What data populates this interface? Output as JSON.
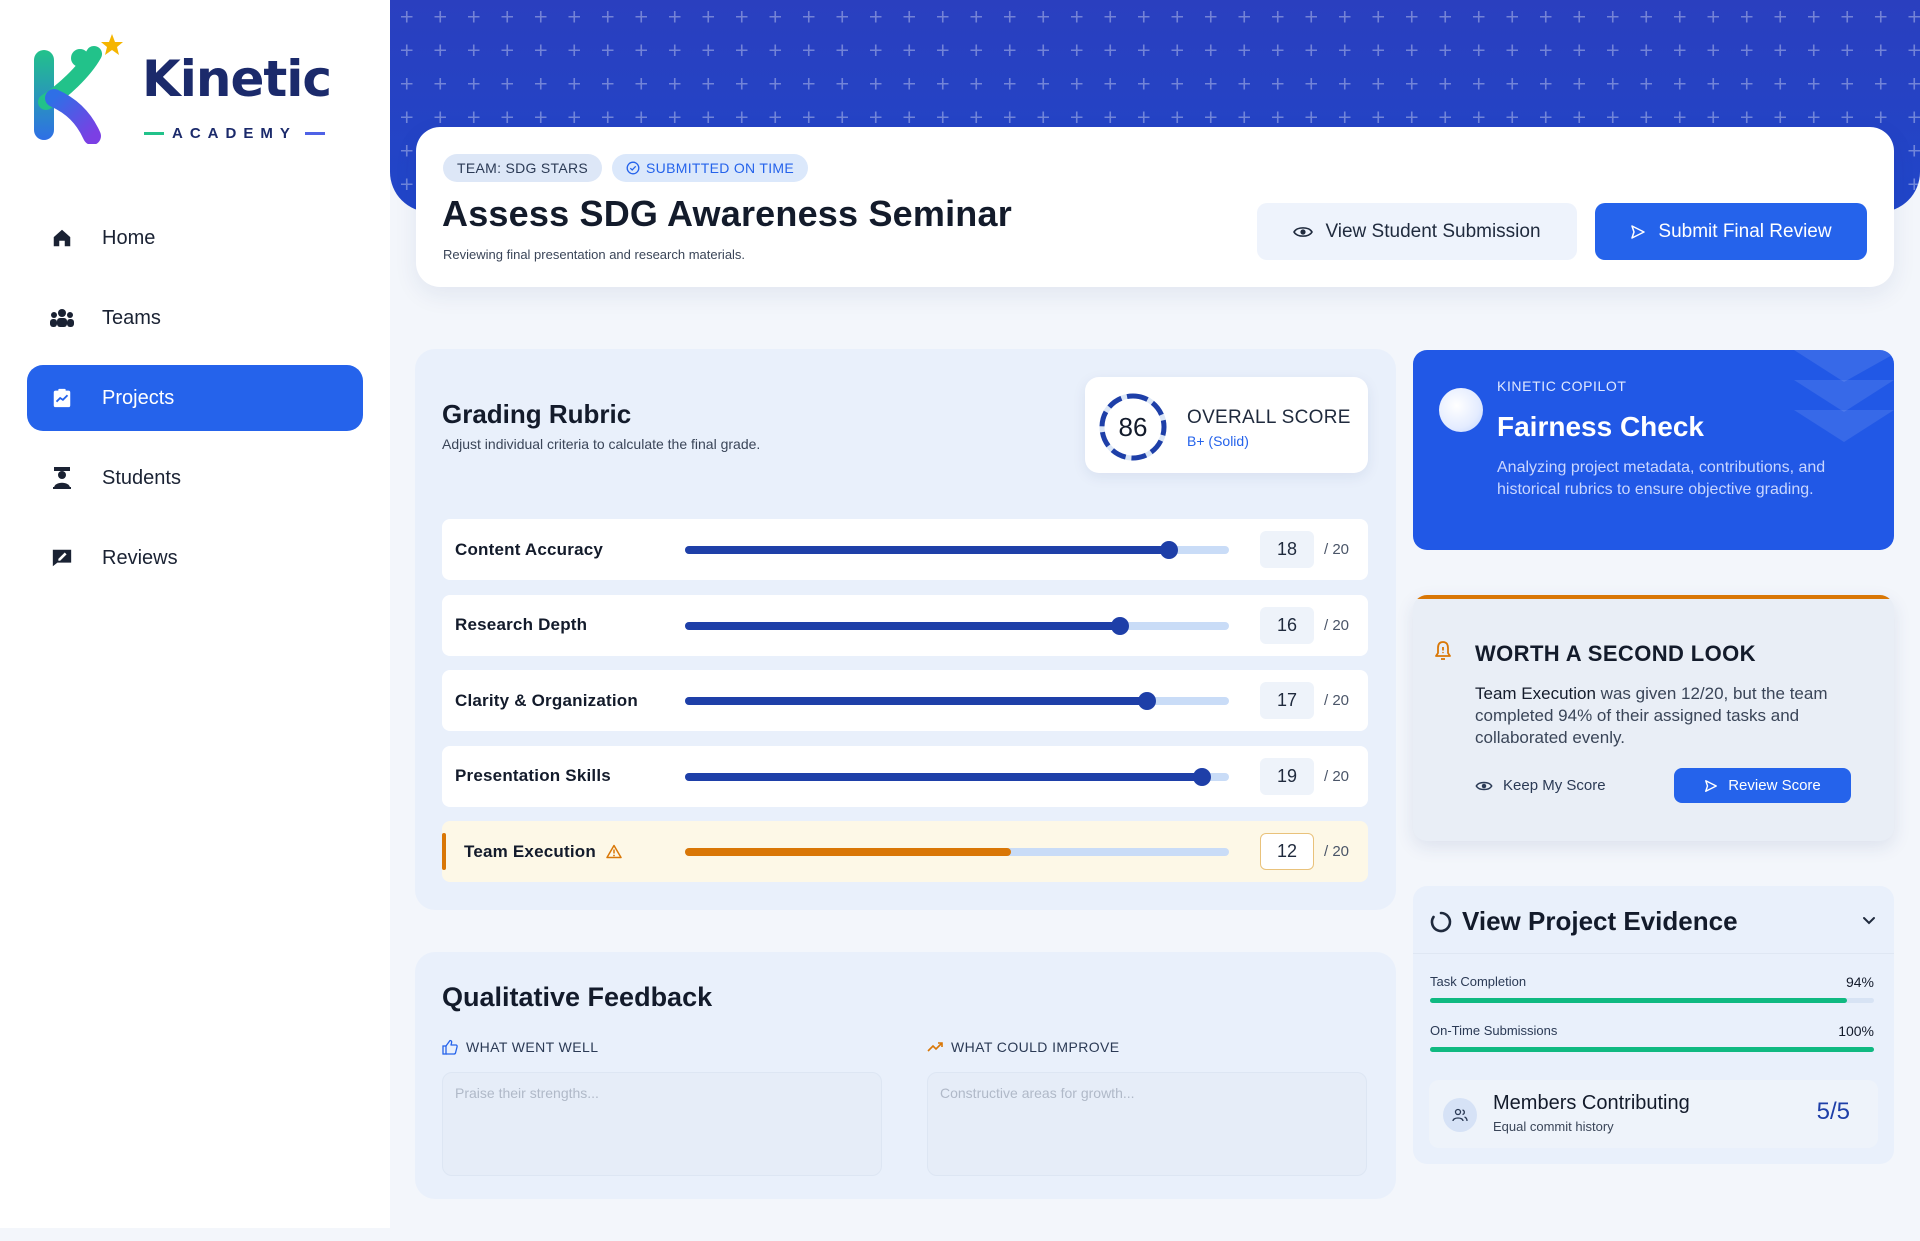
{
  "brand": {
    "name": "Kinetic",
    "sub": "ACADEMY",
    "colors": {
      "navy": "#1b2a6b",
      "green": "#22c28a",
      "blue": "#2f6fe6",
      "star": "#f5b500"
    }
  },
  "nav": {
    "items": [
      {
        "label": "Home",
        "icon": "home-icon"
      },
      {
        "label": "Teams",
        "icon": "users-icon"
      },
      {
        "label": "Projects",
        "icon": "clipboard-chart-icon",
        "active": true
      },
      {
        "label": "Students",
        "icon": "student-icon"
      },
      {
        "label": "Reviews",
        "icon": "message-edit-icon"
      }
    ]
  },
  "header": {
    "team_chip": "TEAM: SDG STARS",
    "status_chip": "SUBMITTED ON TIME",
    "title": "Assess SDG Awareness Seminar",
    "subtitle": "Reviewing final presentation and research materials.",
    "view_button": "View Student Submission",
    "submit_button": "Submit Final Review"
  },
  "rubric": {
    "title": "Grading Rubric",
    "subtitle": "Adjust individual criteria to calculate the final grade.",
    "overall": {
      "score": "86",
      "label": "OVERALL SCORE",
      "grade": "B+ (Solid)",
      "fraction": 0.86
    },
    "criteria": [
      {
        "name": "Content Accuracy",
        "value": 18,
        "max": "/ 20",
        "fraction": 0.89
      },
      {
        "name": "Research Depth",
        "value": 16,
        "max": "/ 20",
        "fraction": 0.8
      },
      {
        "name": "Clarity & Organization",
        "value": 17,
        "max": "/ 20",
        "fraction": 0.85
      },
      {
        "name": "Presentation Skills",
        "value": 19,
        "max": "/ 20",
        "fraction": 0.95
      },
      {
        "name": "Team Execution",
        "value": 12,
        "max": "/ 20",
        "fraction": 0.6,
        "warning": true
      }
    ]
  },
  "feedback": {
    "title": "Qualitative Feedback",
    "went_well_label": "WHAT WENT WELL",
    "went_well_placeholder": "Praise their strengths...",
    "improve_label": "WHAT COULD IMPROVE",
    "improve_placeholder": "Constructive areas for growth..."
  },
  "copilot": {
    "kicker": "KINETIC COPILOT",
    "title": "Fairness Check",
    "description": "Analyzing project metadata, contributions, and historical rubrics to ensure objective grading."
  },
  "second_look": {
    "title": "WORTH A SECOND LOOK",
    "highlight": "Team Execution",
    "text": " was given 12/20, but the team completed 94% of their assigned tasks and collaborated evenly.",
    "keep_button": "Keep My Score",
    "review_button": "Review Score"
  },
  "evidence": {
    "title": "View Project Evidence",
    "metrics": [
      {
        "label": "Task Completion",
        "value": "94%",
        "fraction": 0.94
      },
      {
        "label": "On-Time Submissions",
        "value": "100%",
        "fraction": 1.0
      }
    ],
    "members": {
      "title": "Members Contributing",
      "subtitle": "Equal commit history",
      "value": "5/5"
    }
  }
}
